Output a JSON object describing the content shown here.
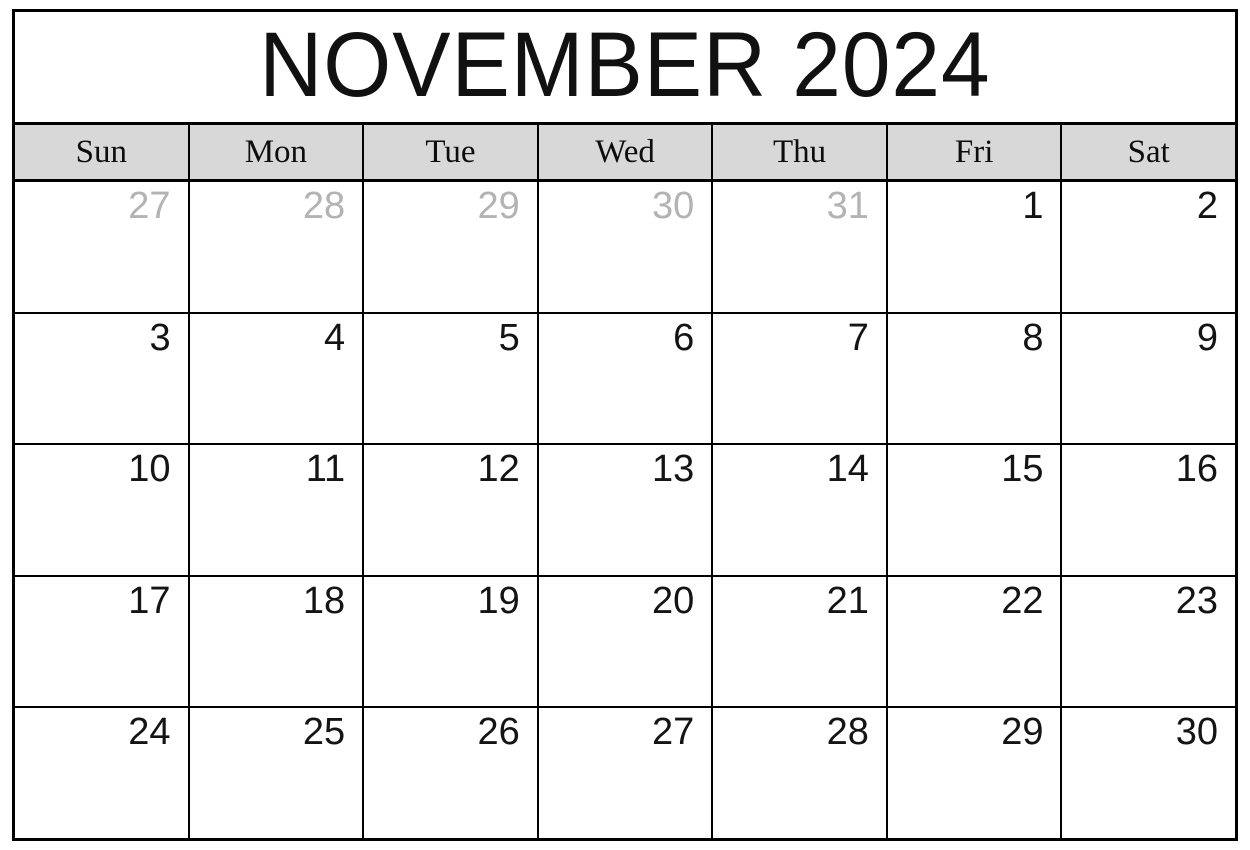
{
  "calendar": {
    "title": "NOVEMBER 2024",
    "month": "NOVEMBER",
    "year": "2024",
    "colors": {
      "border": "#000000",
      "header_background": "#d8d8d8",
      "cell_background": "#ffffff",
      "current_month_text": "#141414",
      "other_month_text": "#b3b3b3"
    },
    "weekdays": [
      {
        "label": "Sun"
      },
      {
        "label": "Mon"
      },
      {
        "label": "Tue"
      },
      {
        "label": "Wed"
      },
      {
        "label": "Thu"
      },
      {
        "label": "Fri"
      },
      {
        "label": "Sat"
      }
    ],
    "weeks": [
      {
        "days": [
          {
            "number": "27",
            "other_month": true
          },
          {
            "number": "28",
            "other_month": true
          },
          {
            "number": "29",
            "other_month": true
          },
          {
            "number": "30",
            "other_month": true
          },
          {
            "number": "31",
            "other_month": true
          },
          {
            "number": "1",
            "other_month": false
          },
          {
            "number": "2",
            "other_month": false
          }
        ]
      },
      {
        "days": [
          {
            "number": "3",
            "other_month": false
          },
          {
            "number": "4",
            "other_month": false
          },
          {
            "number": "5",
            "other_month": false
          },
          {
            "number": "6",
            "other_month": false
          },
          {
            "number": "7",
            "other_month": false
          },
          {
            "number": "8",
            "other_month": false
          },
          {
            "number": "9",
            "other_month": false
          }
        ]
      },
      {
        "days": [
          {
            "number": "10",
            "other_month": false
          },
          {
            "number": "11",
            "other_month": false
          },
          {
            "number": "12",
            "other_month": false
          },
          {
            "number": "13",
            "other_month": false
          },
          {
            "number": "14",
            "other_month": false
          },
          {
            "number": "15",
            "other_month": false
          },
          {
            "number": "16",
            "other_month": false
          }
        ]
      },
      {
        "days": [
          {
            "number": "17",
            "other_month": false
          },
          {
            "number": "18",
            "other_month": false
          },
          {
            "number": "19",
            "other_month": false
          },
          {
            "number": "20",
            "other_month": false
          },
          {
            "number": "21",
            "other_month": false
          },
          {
            "number": "22",
            "other_month": false
          },
          {
            "number": "23",
            "other_month": false
          }
        ]
      },
      {
        "days": [
          {
            "number": "24",
            "other_month": false
          },
          {
            "number": "25",
            "other_month": false
          },
          {
            "number": "26",
            "other_month": false
          },
          {
            "number": "27",
            "other_month": false
          },
          {
            "number": "28",
            "other_month": false
          },
          {
            "number": "29",
            "other_month": false
          },
          {
            "number": "30",
            "other_month": false
          }
        ]
      }
    ]
  }
}
